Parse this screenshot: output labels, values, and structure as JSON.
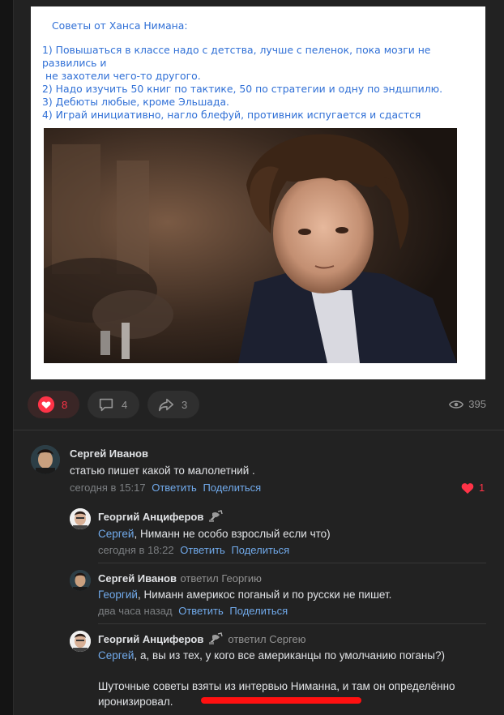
{
  "post": {
    "advice_title": "Советы от Ханса Нимана:",
    "advice_lines": [
      "1) Повышаться в классе надо с детства, лучше с пеленок, пока мозги не развились и",
      "не захотели чего-то другого.",
      "2) Надо изучить 50 книг по тактике, 50 по стратегии и одну по эндшпилю.",
      "3) Дебюты любые, кроме Эльшада.",
      "4) Играй инициативно, нагло блефуй, противник испугается и сдастся"
    ]
  },
  "actions": {
    "likes": "8",
    "comments": "4",
    "shares": "3",
    "views": "395"
  },
  "colors": {
    "background": "#222222",
    "link": "#71aaeb",
    "like_red": "#ff3347",
    "advice_blue": "#2f6fd6",
    "underline_red": "#ff1010"
  },
  "comments": [
    {
      "author": "Сергей Иванов",
      "text": "статью пишет какой то малолетний .",
      "time": "сегодня в 15:17",
      "reply_label": "Ответить",
      "share_label": "Поделиться",
      "likes": "1"
    },
    {
      "author": "Георгий Анциферов",
      "mention": "Сергей",
      "text": ", Ниманн не особо взрослый если что)",
      "time": "сегодня в 18:22",
      "reply_label": "Ответить",
      "share_label": "Поделиться"
    },
    {
      "author": "Сергей Иванов",
      "replied_to": "ответил Георгию",
      "mention": "Георгий",
      "text": ", Ниманн америкос поганый и по русски не пишет.",
      "time": "два часа назад",
      "reply_label": "Ответить",
      "share_label": "Поделиться"
    },
    {
      "author": "Георгий Анциферов",
      "replied_to": "ответил Сергею",
      "mention": "Сергей",
      "text": ", а, вы из тех, у кого все американцы по умолчанию поганы?)",
      "text2": "Шуточные советы взяты из интервью Ниманна, и там он определённо",
      "text3": "иронизировал."
    }
  ]
}
